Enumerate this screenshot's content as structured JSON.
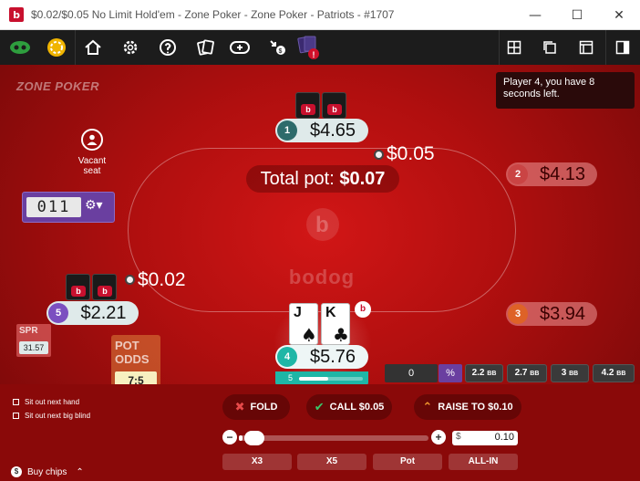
{
  "window": {
    "title": "$0.02/$0.05 No Limit Hold'em - Zone Poker - Zone Poker - Patriots - #1707",
    "app_icon_letter": "b",
    "minimize": "—",
    "maximize": "☐",
    "close": "✕"
  },
  "toolbar": {
    "icons": [
      "lobby-icon",
      "chips-icon",
      "home-icon",
      "settings-icon",
      "help-icon",
      "cards-icon",
      "add-table-icon",
      "rewards-icon",
      "notifications-icon"
    ],
    "layout_icons": [
      "grid-layout-icon",
      "cascade-layout-icon",
      "window-layout-icon",
      "sidebar-layout-icon"
    ]
  },
  "brand": "ZONE POKER",
  "notice": "Player 4, you have 8 seconds left.",
  "pot": {
    "label": "Total pot:",
    "amount": "$0.07"
  },
  "felt_logo": "b",
  "felt_wordmark": "bodog",
  "seats": [
    {
      "num": "1",
      "stack": "$4.65",
      "color": "#2e6b6b",
      "status": "active"
    },
    {
      "num": "2",
      "stack": "$4.13",
      "color": "#c44",
      "status": "folded"
    },
    {
      "num": "3",
      "stack": "$3.94",
      "color": "#e0641e",
      "status": "folded"
    },
    {
      "num": "4",
      "stack": "$5.76",
      "color": "#1fb6a6",
      "status": "hero"
    },
    {
      "num": "5",
      "stack": "$2.21",
      "color": "#7b4fc0",
      "status": "active"
    }
  ],
  "bets": {
    "seat1": "$0.05",
    "seat5": "$0.02"
  },
  "hero_cards": [
    {
      "rank": "J",
      "suit": "♠"
    },
    {
      "rank": "K",
      "suit": "♣"
    }
  ],
  "card_back_logo": "b",
  "dealer_button": "b",
  "hero_timer": {
    "label": "5",
    "fraction": 0.45
  },
  "vacant": {
    "label1": "Vacant",
    "label2": "seat"
  },
  "timebank": {
    "display": "011",
    "gear": "⚙▾"
  },
  "spr": {
    "label": "SPR",
    "value": "31.57"
  },
  "pot_odds": {
    "label": "POT ODDS",
    "value": "7:5"
  },
  "bet_presets": {
    "input_value": "0",
    "pct_label": "%",
    "items": [
      {
        "value": "2.2",
        "unit": "BB"
      },
      {
        "value": "2.7",
        "unit": "BB"
      },
      {
        "value": "3",
        "unit": "BB"
      },
      {
        "value": "4.2",
        "unit": "BB"
      }
    ]
  },
  "sitout": {
    "next_hand": "Sit out next hand",
    "next_big_blind": "Sit out next big blind"
  },
  "actions": {
    "fold": "FOLD",
    "call": "CALL $0.05",
    "raise": "RAISE TO $0.10",
    "fold_icon": "✖",
    "call_icon": "✔",
    "raise_icon": "⌃"
  },
  "raise_slider": {
    "fraction": 0.02,
    "minus": "−",
    "plus": "+",
    "currency": "$",
    "amount": "0.10"
  },
  "quick_bets": [
    "X3",
    "X5",
    "Pot",
    "ALL-IN"
  ],
  "buy_chips": {
    "icon": "$",
    "label": "Buy chips",
    "chevron": "⌃"
  },
  "colors": {
    "accent": "#1fb6a6",
    "table": "#b10f0f",
    "brand_red": "#c8102e",
    "timebank": "#6a3fa0"
  }
}
